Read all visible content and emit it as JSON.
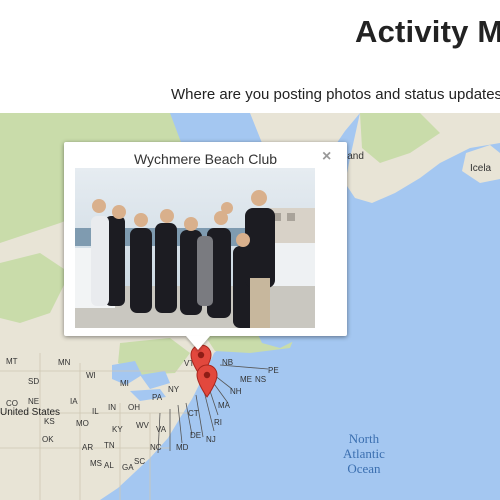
{
  "header": {
    "title": "Activity Ma",
    "subtitle": "Where are you posting photos and status updates?"
  },
  "map": {
    "water_color": "#a4c7f1",
    "land_color": "#e8e4d6",
    "forest_color": "#c9dcaa",
    "labels": {
      "greenland_fragment": "land",
      "iceland_fragment": "Icela",
      "united_states": "United States",
      "ocean": [
        "North",
        "Atlantic",
        "Ocean"
      ]
    },
    "states": [
      "SD",
      "MN",
      "WI",
      "MI",
      "NB",
      "NH",
      "PE",
      "IA",
      "IL",
      "IN",
      "OH",
      "PA",
      "NY",
      "VT",
      "MA",
      "CT",
      "RI",
      "NJ",
      "DE",
      "MD",
      "VA",
      "WV",
      "KY",
      "MO",
      "KS",
      "OK",
      "TN",
      "NC",
      "AR",
      "SC",
      "MS",
      "AL",
      "GA",
      "CO",
      "NE",
      "MT",
      "NS",
      "ME"
    ],
    "pins": [
      "pin-1",
      "pin-2"
    ]
  },
  "infowindow": {
    "title": "Wychmere Beach Club",
    "close_glyph": "×"
  }
}
